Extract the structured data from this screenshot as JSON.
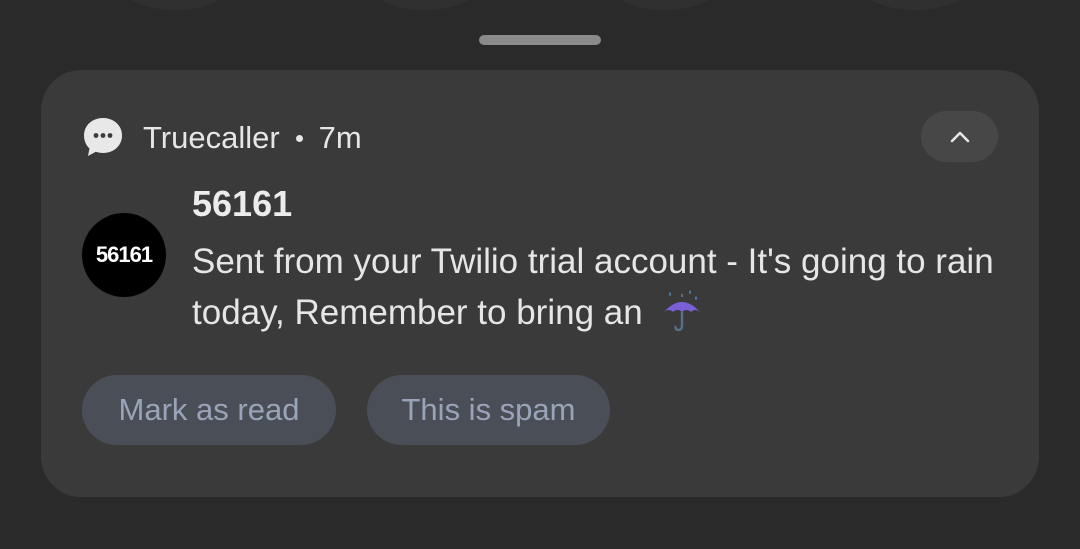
{
  "notification": {
    "app_name": "Truecaller",
    "time": "7m",
    "sender": "56161",
    "avatar_text": "56161",
    "message": "Sent from your Twilio trial account - It's going to rain today, Remember to bring an",
    "emoji_icon": "umbrella-with-rain-icon"
  },
  "actions": {
    "mark_read_label": "Mark as read",
    "spam_label": "This is spam"
  },
  "colors": {
    "card": "#3a3a3a",
    "action_button": "#4a4f57",
    "action_text": "#9aa4b8",
    "avatar": "#000000"
  }
}
